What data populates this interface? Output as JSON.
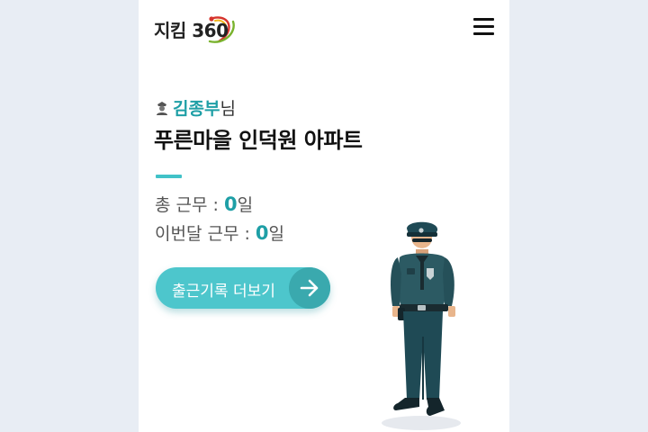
{
  "header": {
    "logo_text": "지킴 360",
    "menu_icon": "hamburger-menu-icon"
  },
  "greeting": {
    "icon": "user-icon",
    "name": "김종부",
    "suffix": "님"
  },
  "apartment": {
    "name": "푸른마을 인덕원 아파트"
  },
  "stats": {
    "total_label": "총 근무 : ",
    "total_value": "0",
    "total_unit": "일",
    "month_label": "이번달 근무 : ",
    "month_value": "0",
    "month_unit": "일"
  },
  "actions": {
    "more_label": "출근기록 더보기",
    "more_icon": "arrow-right-icon"
  },
  "colors": {
    "accent": "#1e9fa6",
    "button": "#4dc6cc",
    "background": "#e8edf4"
  }
}
